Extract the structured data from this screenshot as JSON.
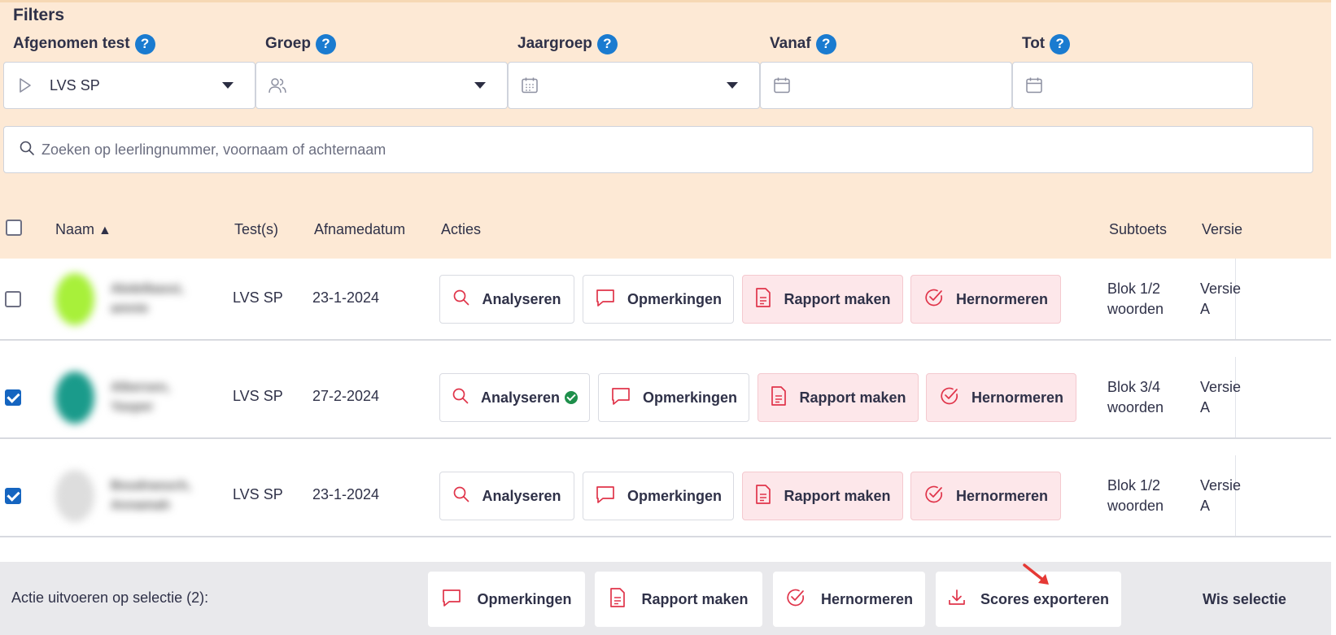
{
  "filters": {
    "title": "Filters",
    "afgenomen_test": {
      "label": "Afgenomen test",
      "value": "LVS SP"
    },
    "groep": {
      "label": "Groep",
      "value": ""
    },
    "jaargroep": {
      "label": "Jaargroep",
      "value": ""
    },
    "vanaf": {
      "label": "Vanaf",
      "value": ""
    },
    "tot": {
      "label": "Tot",
      "value": ""
    },
    "help_glyph": "?"
  },
  "search": {
    "placeholder": "Zoeken op leerlingnummer, voornaam of achternaam",
    "value": ""
  },
  "table": {
    "headers": {
      "naam": "Naam",
      "sort_indicator": "▲",
      "tests": "Test(s)",
      "afnamedatum": "Afnamedatum",
      "acties": "Acties",
      "subtoets": "Subtoets",
      "versie": "Versie"
    },
    "actions": {
      "analyseren": "Analyseren",
      "opmerkingen": "Opmerkingen",
      "rapport": "Rapport maken",
      "hernormeren": "Hernormeren"
    },
    "rows": [
      {
        "checked": false,
        "avatar_color": "#a8f03a",
        "name": "Abdelbassi, amnie",
        "test": "LVS SP",
        "date": "23-1-2024",
        "analysed": false,
        "subtoets_line1": "Blok 1/2",
        "subtoets_line2": "woorden",
        "versie_line1": "Versie",
        "versie_line2": "A"
      },
      {
        "checked": true,
        "avatar_color": "#1a9b8b",
        "name": "Albersen, Yasper",
        "test": "LVS SP",
        "date": "27-2-2024",
        "analysed": true,
        "subtoets_line1": "Blok 3/4",
        "subtoets_line2": "woorden",
        "versie_line1": "Versie",
        "versie_line2": "A"
      },
      {
        "checked": true,
        "avatar_color": "#dddddd",
        "name": "Boudraouch, Annamah",
        "test": "LVS SP",
        "date": "23-1-2024",
        "analysed": false,
        "subtoets_line1": "Blok 1/2",
        "subtoets_line2": "woorden",
        "versie_line1": "Versie",
        "versie_line2": "A"
      }
    ]
  },
  "bottombar": {
    "label": "Actie uitvoeren op selectie (2):",
    "opmerkingen": "Opmerkingen",
    "rapport": "Rapport maken",
    "hernormeren": "Hernormeren",
    "exporteren": "Scores exporteren",
    "wis": "Wis selectie"
  },
  "colors": {
    "accent_red": "#e0344a",
    "help_blue": "#1a7bd0",
    "checkbox_blue": "#1565c0",
    "filters_bg": "#fde9d5"
  }
}
